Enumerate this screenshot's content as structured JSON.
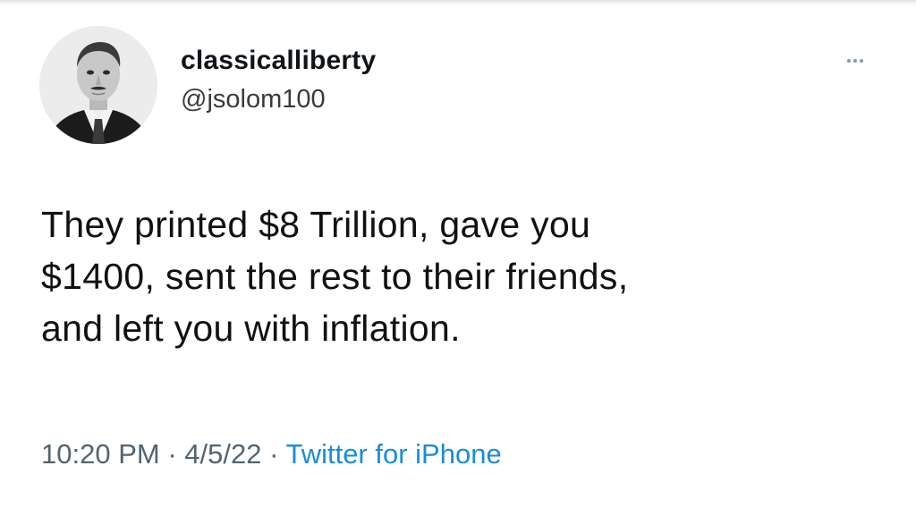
{
  "tweet": {
    "display_name": "classicalliberty",
    "handle": "@jsolom100",
    "avatar_icon": "profile-photo",
    "more_icon": "more-horizontal-icon",
    "text_lines": [
      "They printed $8 Trillion, gave you",
      "$1400, sent the rest to their friends,",
      "and left you with inflation."
    ],
    "time": "10:20 PM",
    "separator": " · ",
    "date": "4/5/22",
    "source": "Twitter for iPhone"
  },
  "colors": {
    "text": "#0f1419",
    "secondary": "#536471",
    "link": "#1a8cd8"
  }
}
